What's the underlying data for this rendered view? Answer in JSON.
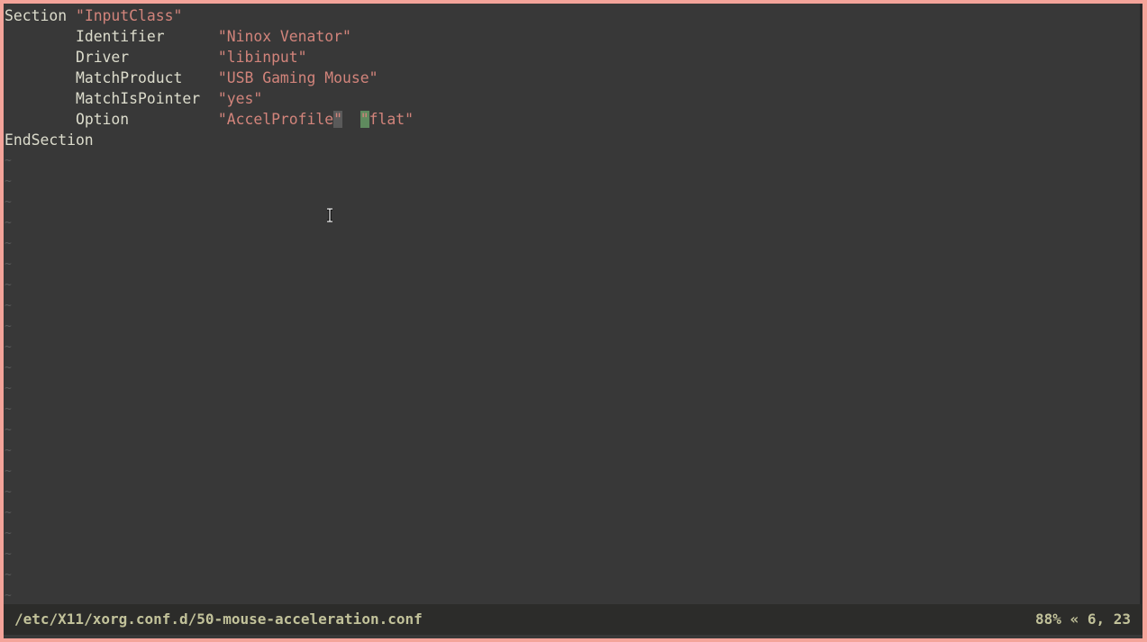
{
  "editor": {
    "lines": [
      {
        "indent": "",
        "key": "Section",
        "gap": " ",
        "value": "\"InputClass\""
      },
      {
        "indent": "        ",
        "key": "Identifier",
        "gap": "      ",
        "value": "\"Ninox Venator\""
      },
      {
        "indent": "        ",
        "key": "Driver",
        "gap": "          ",
        "value": "\"libinput\""
      },
      {
        "indent": "        ",
        "key": "MatchProduct",
        "gap": "    ",
        "value": "\"USB Gaming Mouse\""
      },
      {
        "indent": "        ",
        "key": "MatchIsPointer",
        "gap": "  ",
        "value": "\"yes\""
      }
    ],
    "option_line": {
      "indent": "        ",
      "key": "Option",
      "gap": "          ",
      "value1_body": "\"AccelProfile",
      "value1_close": "\"",
      "spacer": "  ",
      "cursor_char": "\"",
      "value2_rest": "flat\""
    },
    "end_line": "EndSection",
    "empty_line_marker": "~",
    "empty_line_count": 22
  },
  "statusbar": {
    "file_path": "/etc/X11/xorg.conf.d/50-mouse-acceleration.conf",
    "position": "88% « 6, 23"
  },
  "colors": {
    "background": "#383838",
    "border": "#f4a49a",
    "string": "#d2847b",
    "keyword": "#dcdccc",
    "cursor": "#5f8a5e",
    "statusbar_text": "#c2c29a"
  }
}
